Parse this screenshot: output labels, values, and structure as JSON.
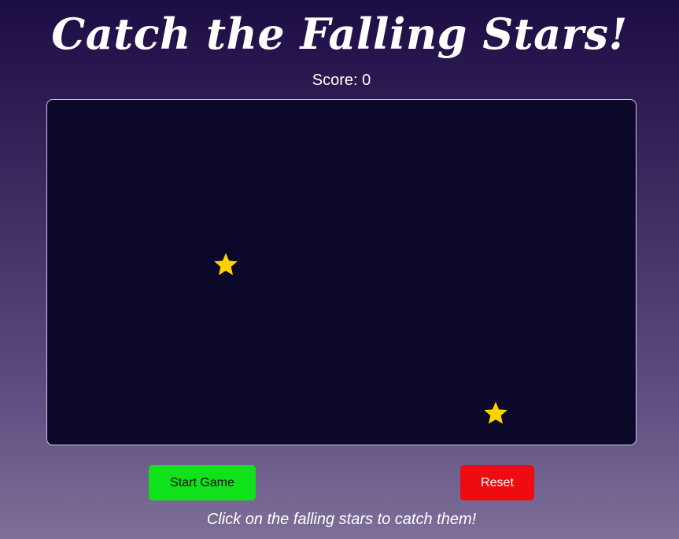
{
  "game": {
    "title": "Catch the Falling Stars!",
    "score_text": "Score: 0",
    "star_icon": "star-icon",
    "stars_visible": 2,
    "buttons": {
      "start_label": "Start Game",
      "reset_label": "Reset"
    },
    "instructions": "Click on the falling stars to catch them!"
  },
  "colors": {
    "background_top": "#1d0d45",
    "background_bottom": "#7e6f99",
    "play_area": "#0b082a",
    "star": "#ffd200",
    "start_button": "#11e11a",
    "reset_button": "#ee0c10"
  }
}
